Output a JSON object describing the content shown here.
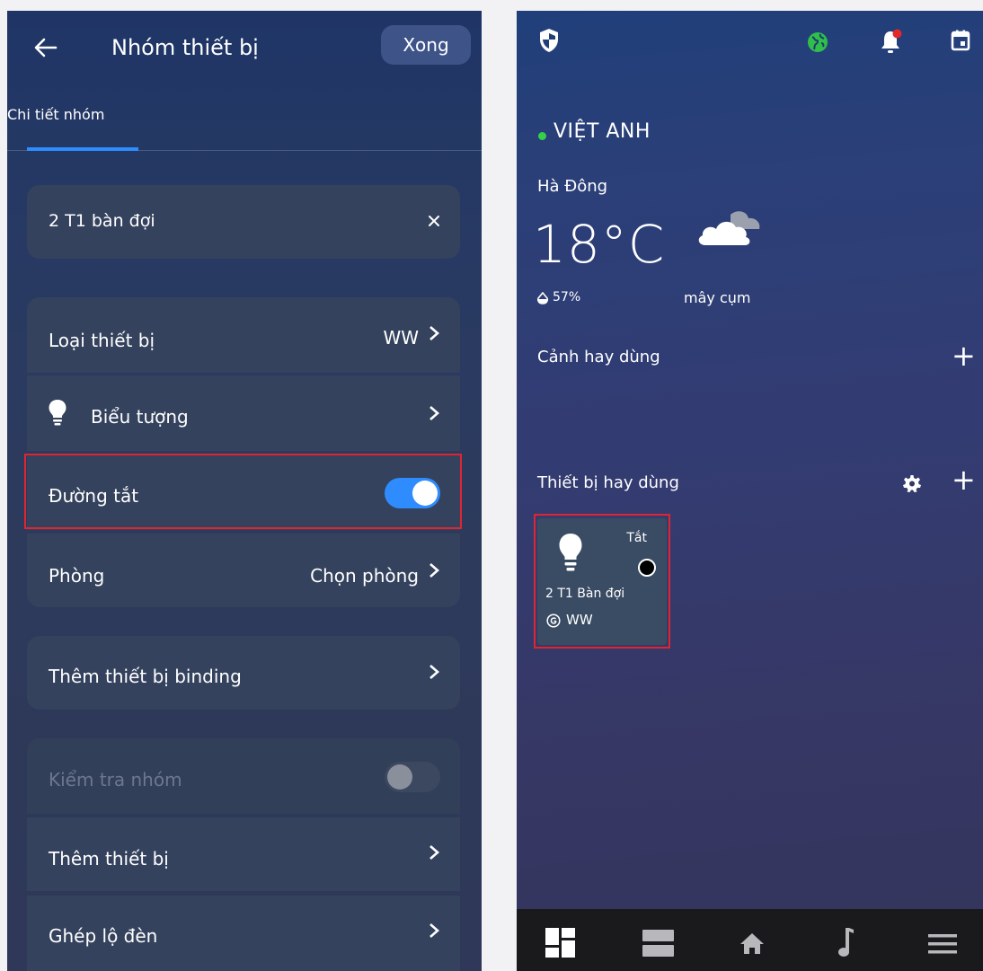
{
  "left": {
    "header": {
      "title": "Nhóm thiết bị",
      "done_label": "Xong"
    },
    "tab": {
      "label": "Chi tiết nhóm"
    },
    "group_name": "2 T1 bàn đợi",
    "rows": {
      "device_type": {
        "label": "Loại thiết bị",
        "value": "WW"
      },
      "icon": {
        "label": "Biểu tượng"
      },
      "shortcut": {
        "label": "Đường tắt",
        "enabled": true
      },
      "room": {
        "label": "Phòng",
        "value": "Chọn phòng"
      },
      "binding": {
        "label": "Thêm thiết bị binding"
      },
      "check_group": {
        "label": "Kiểm tra nhóm",
        "enabled": false
      },
      "add_device": {
        "label": "Thêm thiết bị"
      },
      "pair_light": {
        "label": "Ghép lộ đèn"
      }
    }
  },
  "right": {
    "top_icons": [
      "shield-icon",
      "globe-icon",
      "bell-icon",
      "calendar-icon"
    ],
    "user": {
      "name": "VIỆT ANH",
      "status_color": "#35d04a"
    },
    "weather": {
      "location": "Hà Đông",
      "temperature": "18°C",
      "humidity": "57%",
      "condition": "mây cụm"
    },
    "sections": {
      "scenes": "Cảnh hay dùng",
      "devices": "Thiết bị hay dùng"
    },
    "device_card": {
      "state": "Tắt",
      "name": "2 T1 Bàn đợi",
      "type": "WW"
    },
    "bottom_nav": [
      "dashboard-icon",
      "list-icon",
      "home-icon",
      "music-icon",
      "menu-icon"
    ]
  },
  "colors": {
    "accent": "#2f8cff",
    "highlight": "#e0252f",
    "toggle_on": "#2f8cff"
  }
}
